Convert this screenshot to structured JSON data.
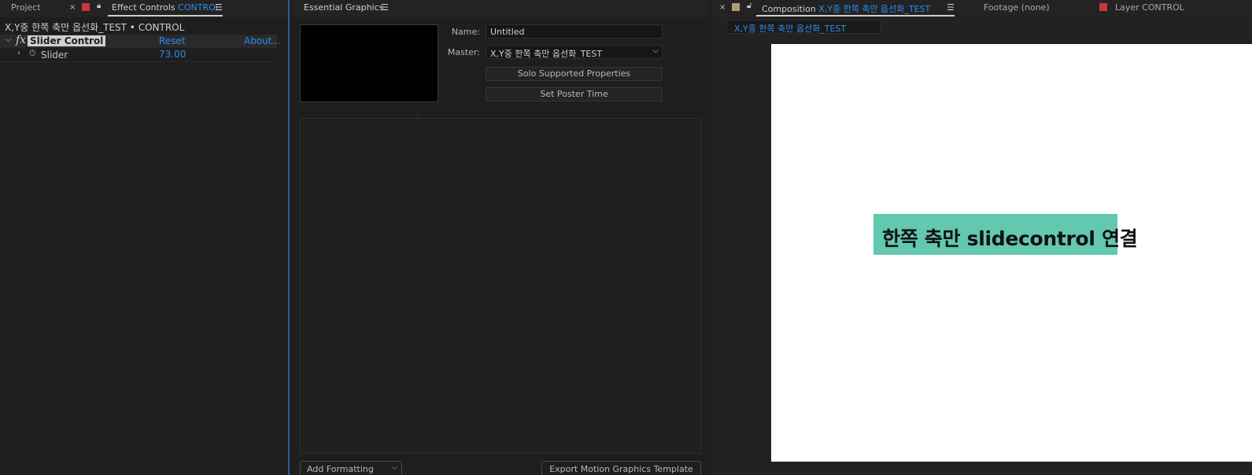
{
  "effect_controls_panel": {
    "tabs": {
      "project": "Project",
      "effect_controls_prefix": "Effect Controls",
      "effect_controls_layer": "CONTROL"
    },
    "header": "X,Y중 한쪽 축만 옵선화_TEST • CONTROL",
    "effect": {
      "name": "Slider Control",
      "reset": "Reset",
      "about": "About..."
    },
    "property": {
      "name": "Slider",
      "value": "73.00"
    }
  },
  "essential_graphics_panel": {
    "title": "Essential Graphics",
    "name_label": "Name:",
    "name_value": "Untitled",
    "master_label": "Master:",
    "master_value": "X,Y중 한쪽 축만 옵선화_TEST",
    "solo_button": "Solo Supported Properties",
    "poster_button": "Set Poster Time",
    "add_formatting": "Add Formatting",
    "export_button": "Export Motion Graphics Template"
  },
  "composition_panel": {
    "tabs": {
      "composition_prefix": "Composition",
      "composition_name": "X,Y중 한쪽 축만 옵선화_TEST",
      "footage": "Footage (none)",
      "layer": "Layer CONTROL"
    },
    "comp_chip": "X,Y중 한쪽 축만 옵선화_TEST",
    "canvas_text": "한쪽 축만 slidecontrol 연결",
    "slider_fill_fraction": 0.73
  },
  "colors": {
    "accent_blue": "#2d8ceb",
    "slider_fill": "#63c8af",
    "label_red": "#c8373a",
    "label_tan": "#b09a7a"
  }
}
